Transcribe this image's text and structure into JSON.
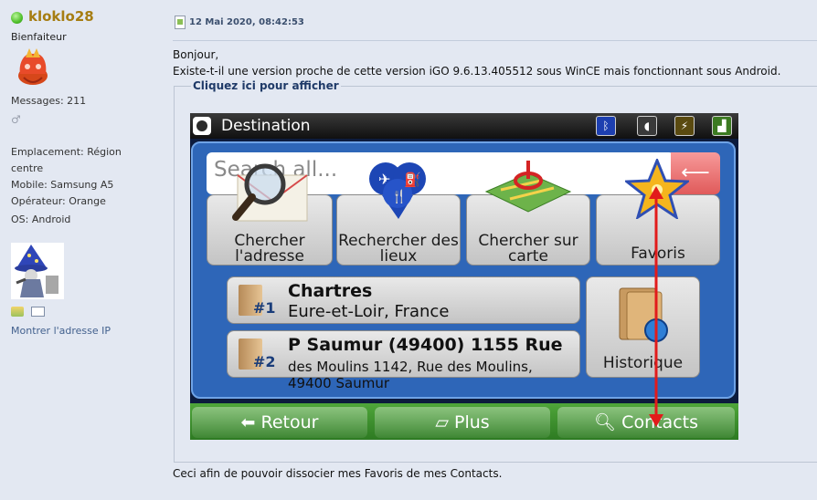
{
  "user": {
    "name": "kloklo28",
    "rank": "Bienfaiteur",
    "messages": "Messages: 211",
    "location": "Emplacement: Région centre",
    "mobile": "Mobile: Samsung A5",
    "operator": "Opérateur: Orange",
    "os": "OS: Android",
    "show_ip": "Montrer l'adresse IP"
  },
  "post": {
    "date": "12 Mai 2020, 08:42:53",
    "greeting": "Bonjour,",
    "question": "Existe-t-il une version proche de cette version iGO 9.6.13.405512 sous WinCE mais fonctionnant sous Android.",
    "spoiler_label": "Cliquez ici pour afficher",
    "footer": "Ceci afin de pouvoir dissocier mes Favoris de mes Contacts."
  },
  "screenshot": {
    "title": "Destination",
    "search_placeholder": "Search all...",
    "buttons": {
      "address": "Chercher l'adresse",
      "places": "Rechercher des lieux",
      "map": "Chercher sur carte",
      "favorites": "Favoris",
      "history": "Historique"
    },
    "recent": [
      {
        "num": "#1",
        "title": "Chartres",
        "sub": "Eure-et-Loir, France"
      },
      {
        "num": "#2",
        "title": "P Saumur (49400) 1155 Rue",
        "sub": "des Moulins 1142, Rue des Moulins, 49400 Saumur"
      }
    ],
    "bottom": {
      "back": "Retour",
      "more": "Plus",
      "contacts": "Contacts"
    }
  },
  "colors": {
    "username": "#a67d12",
    "link": "#43618e",
    "spoiler_label": "#1f3a68",
    "annotation_arrow": "#e21b1b"
  }
}
